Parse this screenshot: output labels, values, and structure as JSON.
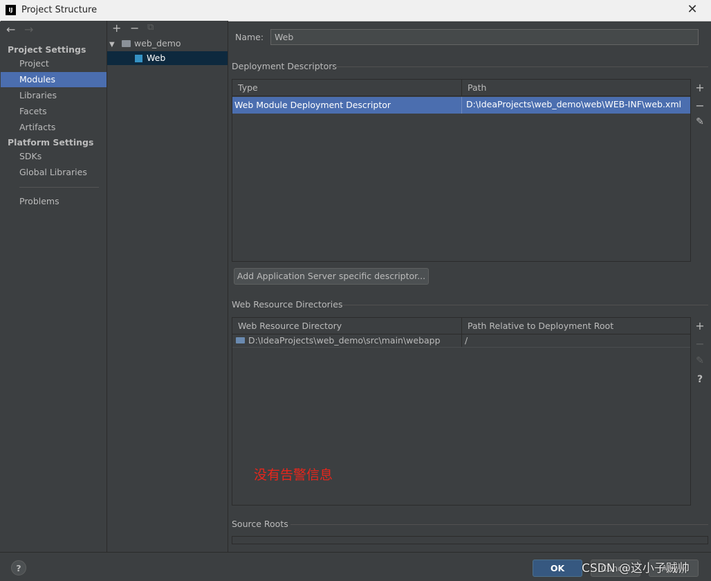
{
  "window": {
    "app_icon_text": "IJ",
    "title": "Project Structure"
  },
  "nav": {
    "project_settings_header": "Project Settings",
    "project_settings_items": [
      {
        "label": "Project"
      },
      {
        "label": "Modules"
      },
      {
        "label": "Libraries"
      },
      {
        "label": "Facets"
      },
      {
        "label": "Artifacts"
      }
    ],
    "platform_settings_header": "Platform Settings",
    "platform_settings_items": [
      {
        "label": "SDKs"
      },
      {
        "label": "Global Libraries"
      }
    ],
    "problems": "Problems"
  },
  "tree": {
    "module": "web_demo",
    "facet": "Web"
  },
  "facet": {
    "name_label": "Name:",
    "name_value": "Web"
  },
  "deployment": {
    "title": "Deployment Descriptors",
    "headers": {
      "type": "Type",
      "path": "Path"
    },
    "rows": [
      {
        "type": "Web Module Deployment Descriptor",
        "path": "D:\\IdeaProjects\\web_demo\\web\\WEB-INF\\web.xml"
      }
    ],
    "add_server_descriptor": "Add Application Server specific descriptor..."
  },
  "resources": {
    "title": "Web Resource Directories",
    "headers": {
      "dir": "Web Resource Directory",
      "rel": "Path Relative to Deployment Root"
    },
    "rows": [
      {
        "dir": "D:\\IdeaProjects\\web_demo\\src\\main\\webapp",
        "rel": "/"
      }
    ]
  },
  "annotation": "没有告警信息",
  "source_roots": {
    "title": "Source Roots"
  },
  "footer": {
    "help": "?",
    "ok": "OK",
    "cancel": "Cancel",
    "apply": "Apply"
  },
  "watermark": "CSDN @这小子贼帅",
  "colors": {
    "background": "#3c3f41",
    "selection": "#4b6eaf",
    "tree_selection": "#0d293e",
    "ok_button": "#365880",
    "annotation": "#e8261c"
  }
}
